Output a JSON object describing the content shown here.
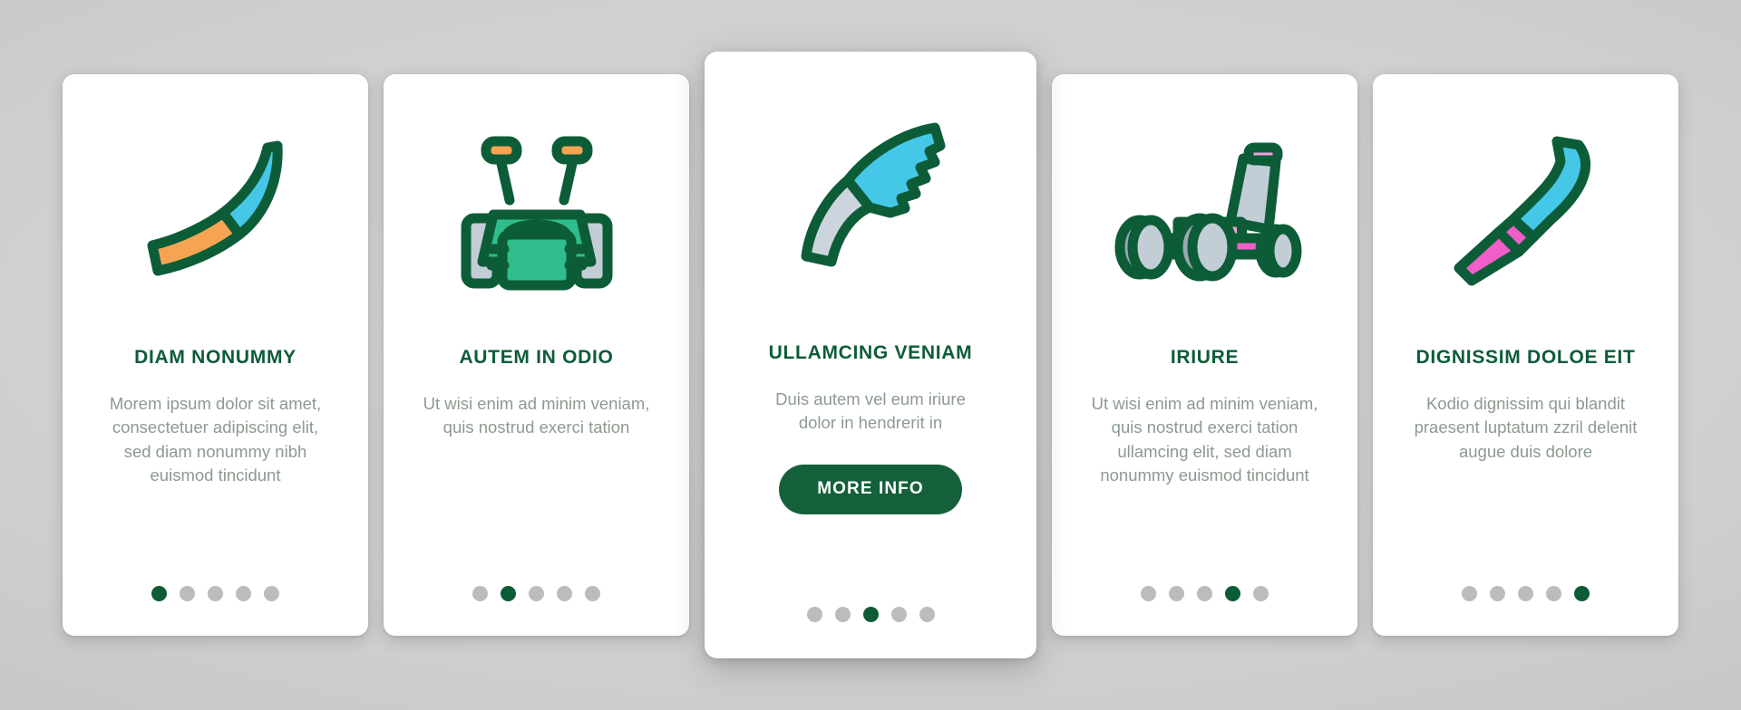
{
  "background": {
    "base_color": "#cfcfcf",
    "edge_color": "#b9b9b9"
  },
  "theme": {
    "title_color": "#0d5c38",
    "body_color": "#8d9a90",
    "card_bg": "#ffffff",
    "button_bg": "#14603a",
    "button_text": "#ffffff",
    "dot_active": "#0d5c38",
    "dot_inactive": "#bcbcbc",
    "icon_outline": "#0d5c38"
  },
  "deck": {
    "total_slides": 5,
    "featured_index": 2,
    "cards": [
      {
        "id": "card-1",
        "icon_name": "scythe-blade-icon",
        "icon_colors": {
          "blade": "#45c8e8",
          "handle": "#f5a453",
          "outline": "#0d5c38"
        },
        "title": "DIAM NONUMMY",
        "body": "Morem ipsum dolor sit amet, consectetuer adipiscing elit, sed diam nonummy nibh euismod tincidunt",
        "has_button": false,
        "button_label": "",
        "active_dot": 0,
        "featured": false
      },
      {
        "id": "card-2",
        "icon_name": "lawn-mower-front-icon",
        "icon_colors": {
          "body": "#2fbd8b",
          "accent": "#f5b942",
          "grip": "#f5a453",
          "wheel": "#c3cdd6",
          "outline": "#0d5c38"
        },
        "title": "AUTEM IN ODIO",
        "body": "Ut wisi enim ad minim veniam, quis nostrud exerci tation",
        "has_button": false,
        "button_label": "",
        "active_dot": 1,
        "featured": false
      },
      {
        "id": "card-3",
        "icon_name": "pruning-saw-icon",
        "icon_colors": {
          "blade": "#45c8e8",
          "handle": "#ccd4dd",
          "outline": "#0d5c38"
        },
        "title": "ULLAMCING VENIAM",
        "body": "Duis autem vel eum iriure dolor in hendrerit in",
        "has_button": true,
        "button_label": "MORE INFO",
        "active_dot": 2,
        "featured": true
      },
      {
        "id": "card-4",
        "icon_name": "lawn-mower-side-icon",
        "icon_colors": {
          "body": "#f05fc8",
          "accent": "#f3a0dd",
          "panel": "#c3cdd6",
          "wheel": "#c3cdd6",
          "outline": "#0d5c38"
        },
        "title": "IRIURE",
        "body": "Ut wisi enim ad minim veniam, quis nostrud exerci tation ullamcing elit, sed diam nonummy euismod tincidunt",
        "has_button": false,
        "button_label": "",
        "active_dot": 3,
        "featured": false
      },
      {
        "id": "card-5",
        "icon_name": "hand-scythe-icon",
        "icon_colors": {
          "blade": "#45c8e8",
          "handle": "#f05fc8",
          "outline": "#0d5c38"
        },
        "title": "DIGNISSIM DOLOE EIT",
        "body": "Kodio dignissim qui blandit praesent luptatum zzril delenit augue duis dolore",
        "has_button": false,
        "button_label": "",
        "active_dot": 4,
        "featured": false
      }
    ]
  }
}
